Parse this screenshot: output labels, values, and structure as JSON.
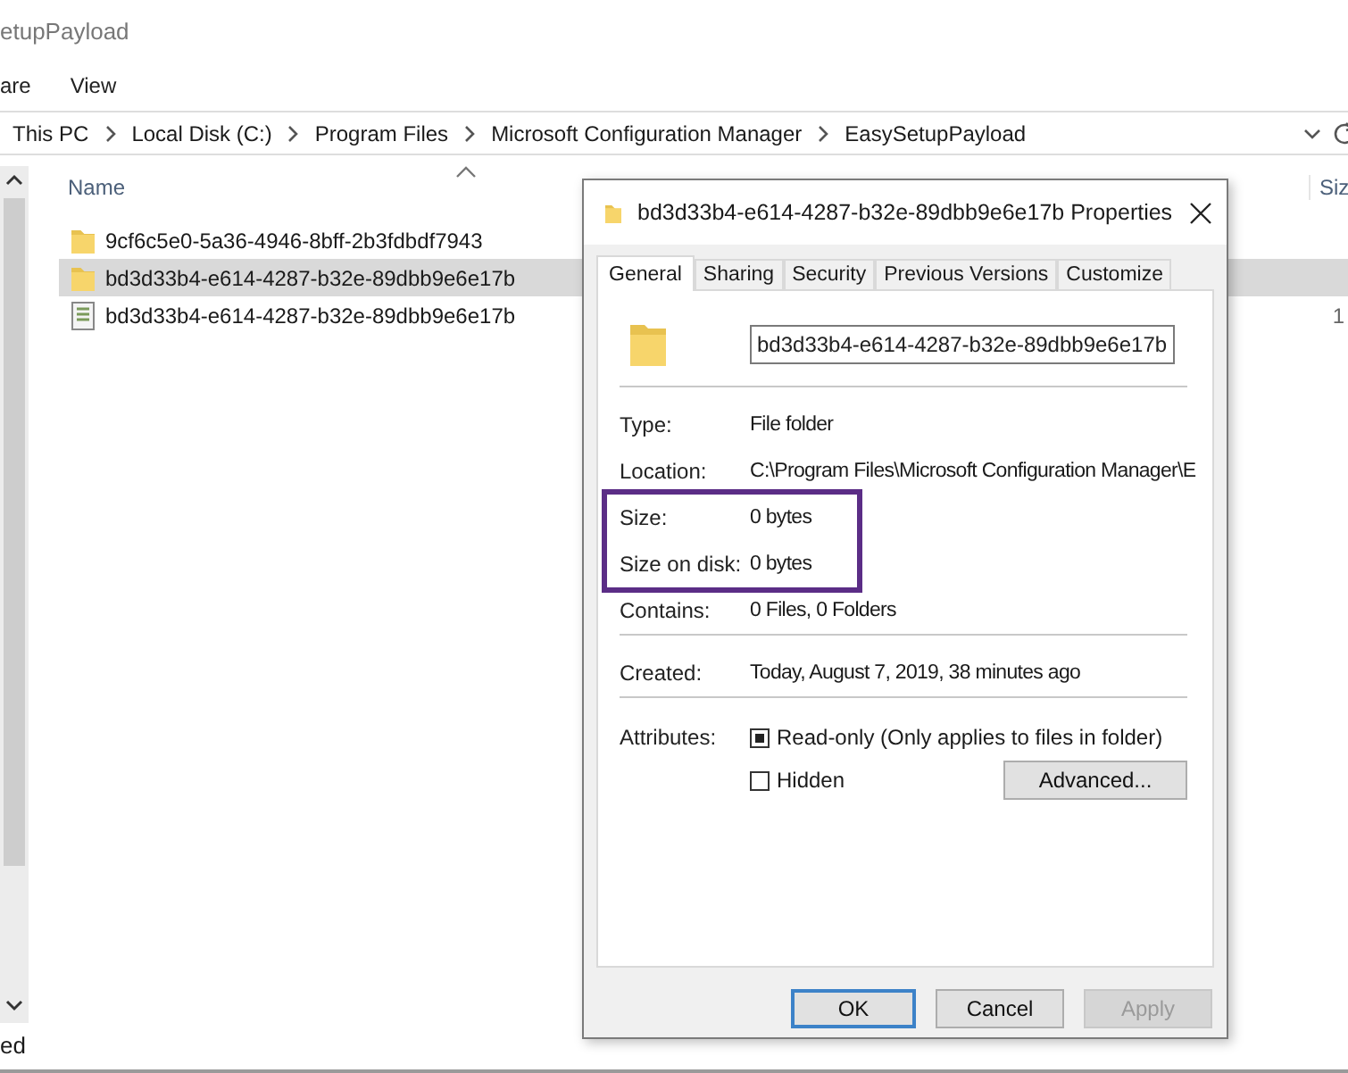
{
  "explorer": {
    "title": "etupPayload",
    "ribbon_tabs": [
      "are",
      "View"
    ],
    "breadcrumb": [
      "This PC",
      "Local Disk (C:)",
      "Program Files",
      "Microsoft Configuration Manager",
      "EasySetupPayload"
    ],
    "columns": [
      "Name",
      "Siz"
    ],
    "rows": [
      {
        "name": "9cf6c5e0-5a36-4946-8bff-2b3fdbdf7943",
        "kind": "folder",
        "selected": false
      },
      {
        "name": "bd3d33b4-e614-4287-b32e-89dbb9e6e17b",
        "kind": "folder",
        "selected": true
      },
      {
        "name": "bd3d33b4-e614-4287-b32e-89dbb9e6e17b",
        "kind": "file",
        "selected": false,
        "column_2": "1"
      }
    ],
    "status_bar": "ed"
  },
  "dialog": {
    "title": "bd3d33b4-e614-4287-b32e-89dbb9e6e17b Properties",
    "tabs": [
      {
        "label": "General",
        "selected": true
      },
      {
        "label": "Sharing",
        "selected": false
      },
      {
        "label": "Security",
        "selected": false
      },
      {
        "label": "Previous Versions",
        "selected": false
      },
      {
        "label": "Customize",
        "selected": false
      }
    ],
    "name_value": "bd3d33b4-e614-4287-b32e-89dbb9e6e17b",
    "sections": [
      [
        {
          "label": "Type:",
          "value": "File folder",
          "highlighted": false
        },
        {
          "label": "Location:",
          "value": "C:\\Program Files\\Microsoft Configuration Manager\\E",
          "highlighted": false
        },
        {
          "label": "Size:",
          "value": "0 bytes",
          "highlighted": true
        },
        {
          "label": "Size on disk:",
          "value": "0 bytes",
          "highlighted": true
        },
        {
          "label": "Contains:",
          "value": "0 Files, 0 Folders",
          "highlighted": false
        }
      ],
      [
        {
          "label": "Created:",
          "value": "Today, August 7, 2019, 38 minutes ago",
          "highlighted": false
        }
      ]
    ],
    "attributes_label": "Attributes:",
    "attributes": [
      {
        "label": "Read-only (Only applies to files in folder)",
        "checked": true
      },
      {
        "label": "Hidden",
        "checked": false
      }
    ],
    "advanced_button": "Advanced...",
    "buttons": [
      {
        "label": "OK",
        "kind": "default"
      },
      {
        "label": "Cancel",
        "kind": "normal"
      },
      {
        "label": "Apply",
        "kind": "disabled"
      }
    ]
  }
}
